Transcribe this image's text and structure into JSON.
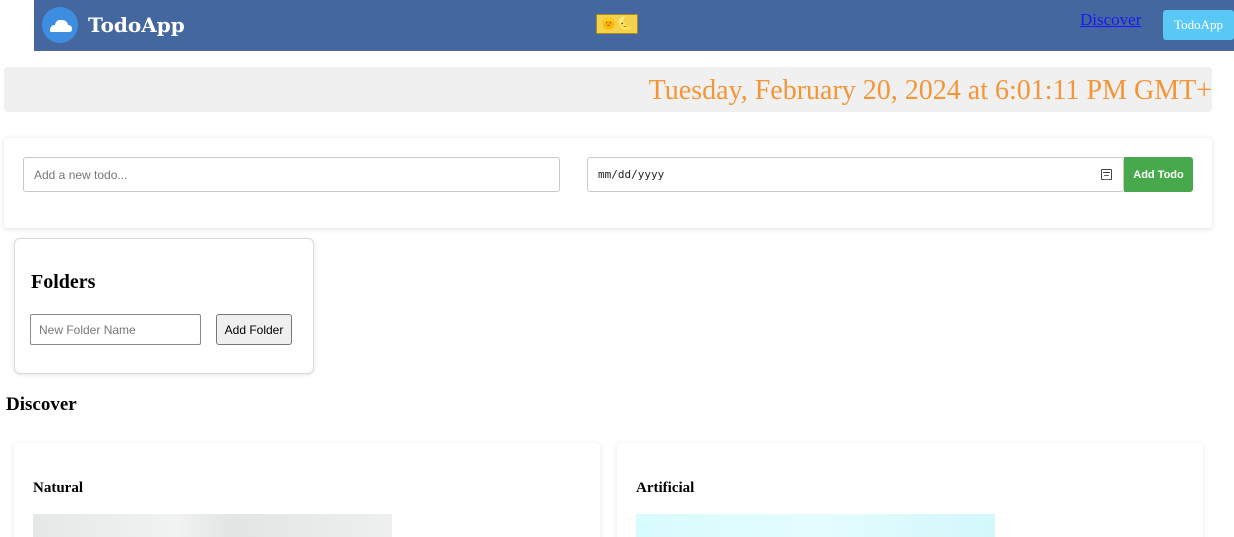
{
  "header": {
    "brand": "TodoApp",
    "theme_toggle_glyphs": "🌞🌜",
    "nav_link": "Discover",
    "nav_button": "TodoApp",
    "colors": {
      "bar": "#4467a0",
      "button": "#59c8f5",
      "link": "#1a1aee"
    }
  },
  "date_banner": {
    "text": "Tuesday, February 20, 2024 at 6:01:11 PM GMT+",
    "color": "#f29637"
  },
  "todo_form": {
    "input_placeholder": "Add a new todo...",
    "input_value": "",
    "date_placeholder": "mm/dd/yyyy",
    "add_button": "Add Todo",
    "add_button_color": "#47a94b"
  },
  "folders": {
    "title": "Folders",
    "input_placeholder": "New Folder Name",
    "add_button": "Add Folder"
  },
  "discover": {
    "title": "Discover",
    "cards": [
      {
        "title": "Natural"
      },
      {
        "title": "Artificial"
      }
    ]
  },
  "icons": {
    "logo": "cloud-icon",
    "theme": "sun-moon-icon",
    "date_picker": "calendar-icon"
  }
}
